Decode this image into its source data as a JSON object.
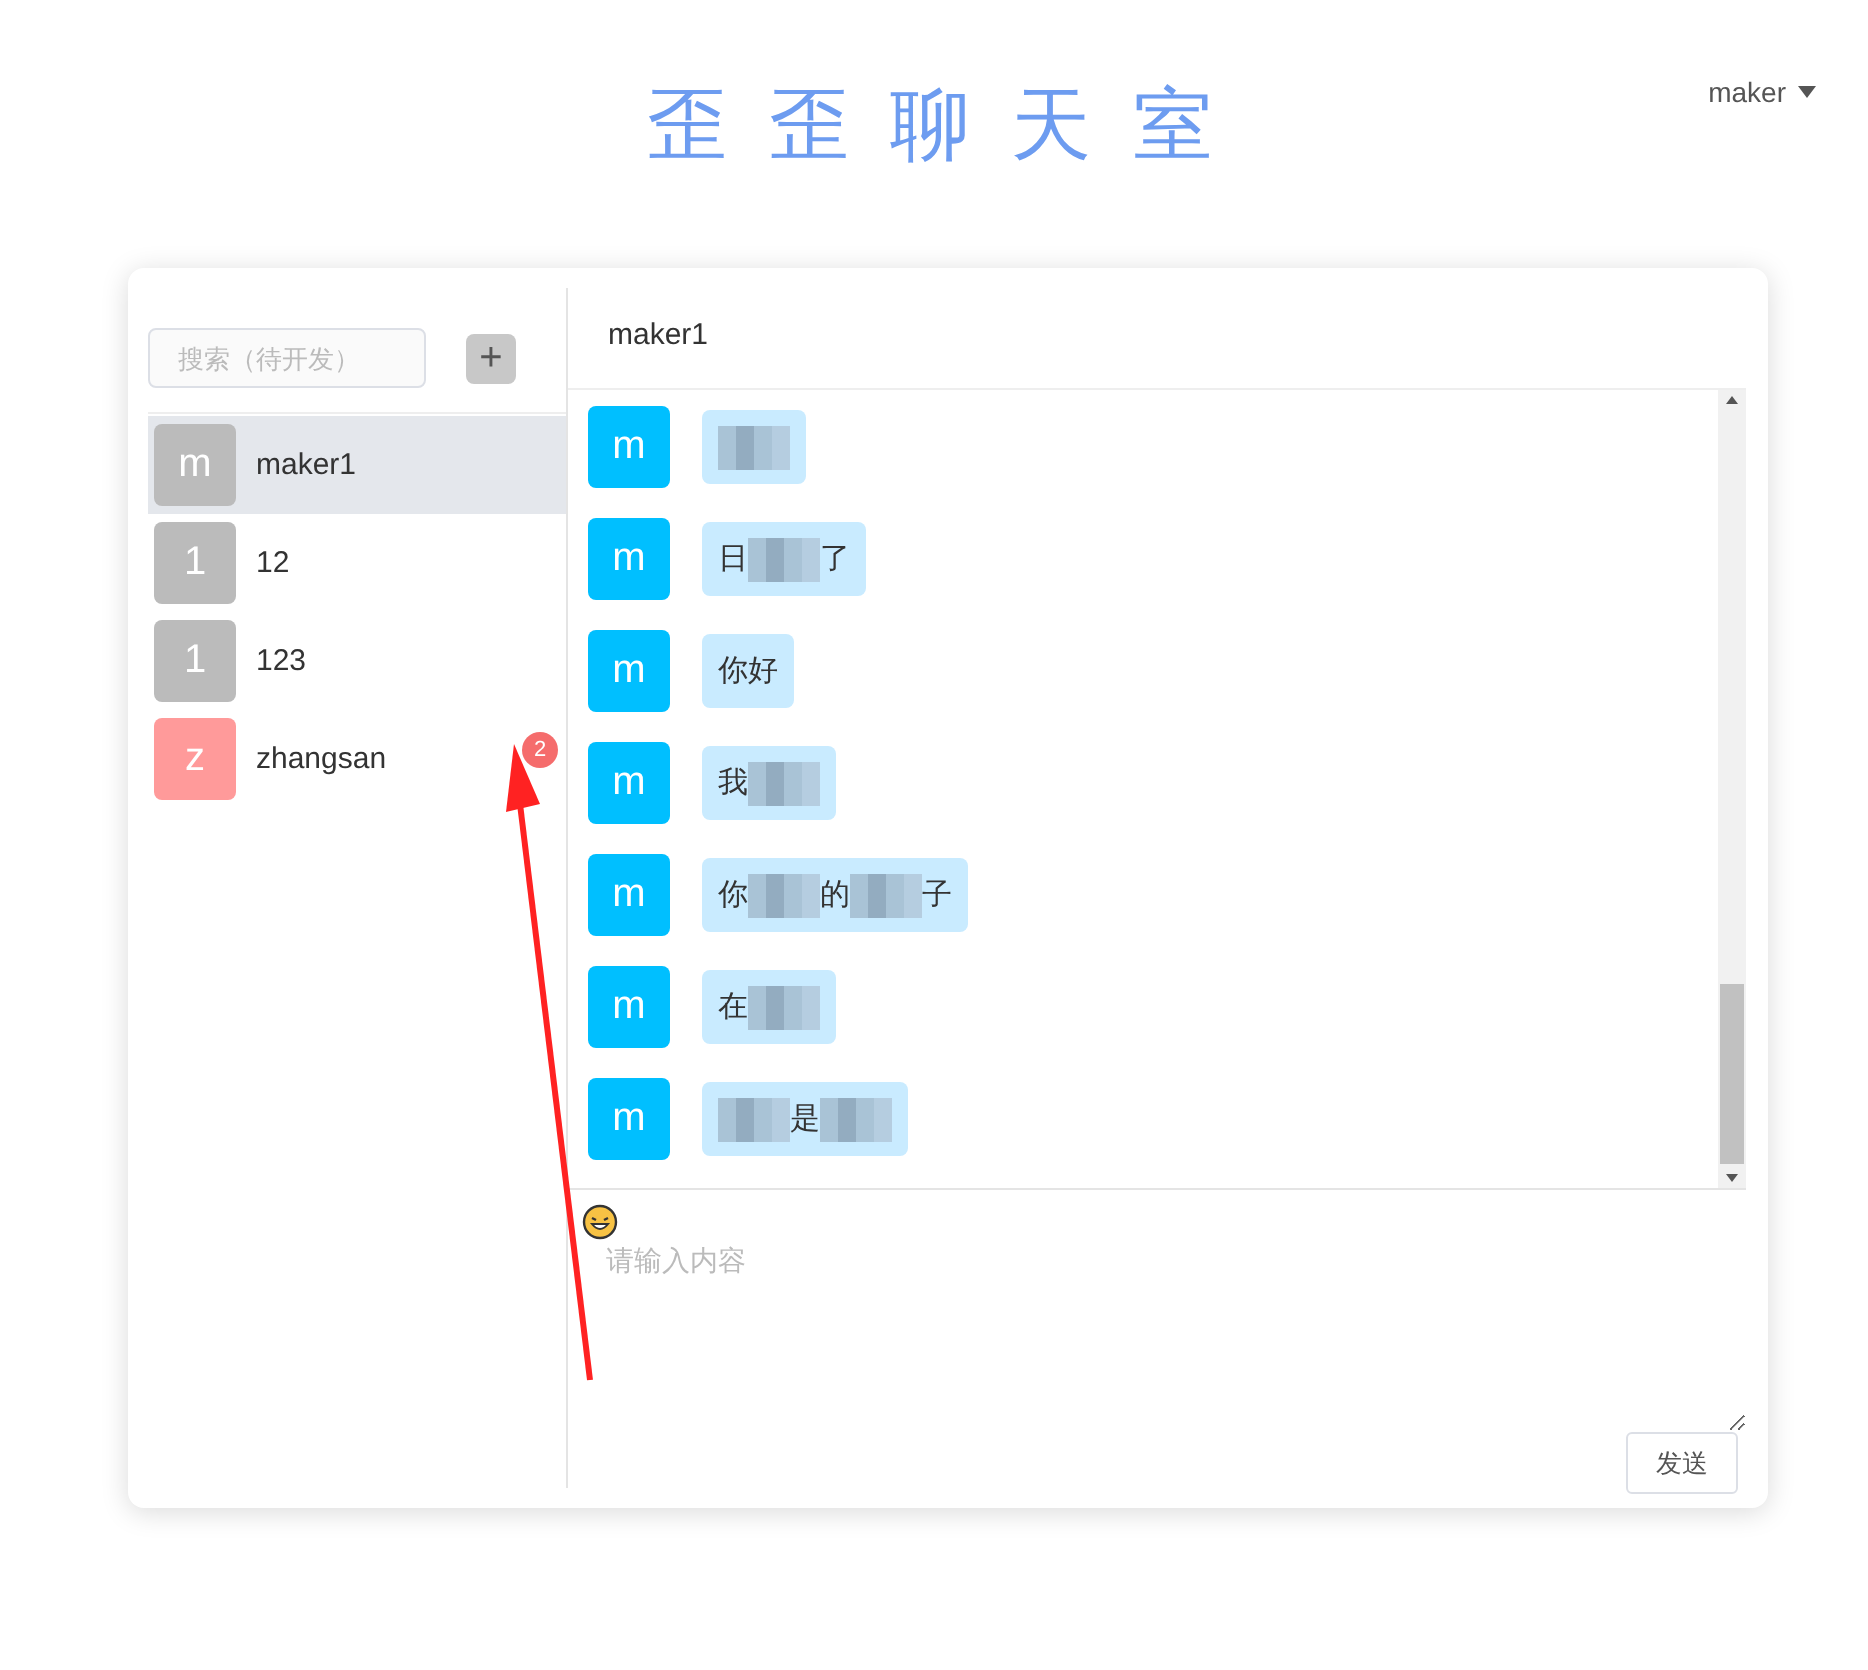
{
  "header": {
    "title": "歪 歪 聊 天 室",
    "user": "maker"
  },
  "sidebar": {
    "search": {
      "placeholder": "搜索（待开发）"
    },
    "add_button": "+",
    "contacts": [
      {
        "initial": "m",
        "name": "maker1",
        "color": "#bbbbbb",
        "selected": true
      },
      {
        "initial": "1",
        "name": "12",
        "color": "#bbbbbb",
        "selected": false
      },
      {
        "initial": "1",
        "name": "123",
        "color": "#bbbbbb",
        "selected": false
      },
      {
        "initial": "z",
        "name": "zhangsan",
        "color": "#ff9a9a",
        "selected": false,
        "badge": "2"
      }
    ]
  },
  "chat": {
    "title": "maker1",
    "messages": [
      {
        "initial": "m",
        "segments": [
          {
            "kind": "blur"
          }
        ]
      },
      {
        "initial": "m",
        "segments": [
          {
            "kind": "text",
            "text": "日"
          },
          {
            "kind": "blur"
          },
          {
            "kind": "text",
            "text": "了"
          }
        ]
      },
      {
        "initial": "m",
        "segments": [
          {
            "kind": "text",
            "text": "你好"
          }
        ]
      },
      {
        "initial": "m",
        "segments": [
          {
            "kind": "text",
            "text": "我"
          },
          {
            "kind": "blur"
          }
        ]
      },
      {
        "initial": "m",
        "segments": [
          {
            "kind": "text",
            "text": "你"
          },
          {
            "kind": "blur"
          },
          {
            "kind": "text",
            "text": "的"
          },
          {
            "kind": "blur"
          },
          {
            "kind": "text",
            "text": "子"
          }
        ]
      },
      {
        "initial": "m",
        "segments": [
          {
            "kind": "text",
            "text": "在"
          },
          {
            "kind": "blur"
          }
        ]
      },
      {
        "initial": "m",
        "segments": [
          {
            "kind": "blur"
          },
          {
            "kind": "text",
            "text": "是"
          },
          {
            "kind": "blur"
          }
        ]
      }
    ],
    "input": {
      "placeholder": "请输入内容"
    },
    "send_button": "发送"
  }
}
